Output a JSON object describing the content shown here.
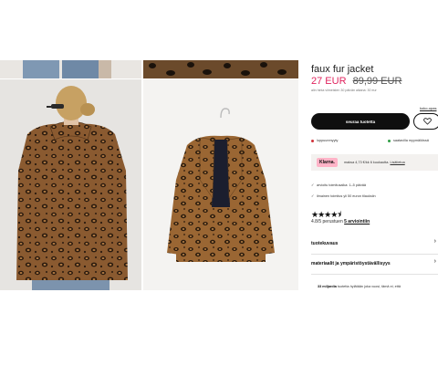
{
  "product": {
    "title": "faux fur jacket",
    "price_now": "27 EUR",
    "price_old": "89,99 EUR",
    "lowest_price_note": "alin hinta viimeisten 30 päivän aikana: 30 eur",
    "size_guide": "koko-opas"
  },
  "actions": {
    "follow_label": "seuraa tuotetta"
  },
  "stock": {
    "out_label": "loppuunmyyty",
    "avail_label": "saatavilla myymälöissä"
  },
  "klarna": {
    "badge": "Klarna.",
    "text": "maksa 4,73 €/kk 6 kuukautta.",
    "link": "Lisätietoa"
  },
  "perks": [
    "arvioitu toimitusaika: 1–5 päivää",
    "ilmainen toimitus yli 50 euron tilauksiin"
  ],
  "rating": {
    "stars": "★★★★⯨",
    "score": "4.8/5 perustuen",
    "count_link": "5 arviointiin"
  },
  "accordion": [
    {
      "label": "tuotekuvaus"
    },
    {
      "label": "materiaalit ja ympäristöystävällisyys"
    }
  ],
  "footnote": {
    "bold": "33 miljardia",
    "rest": "tuotetta hylätään joka vuosi, tämä ei, että"
  },
  "colors": {
    "accent_pink": "#e0245e",
    "klarna_pink": "#ffb3c7",
    "button_black": "#0f0f0f",
    "leopard_base": "#8a5a30"
  }
}
